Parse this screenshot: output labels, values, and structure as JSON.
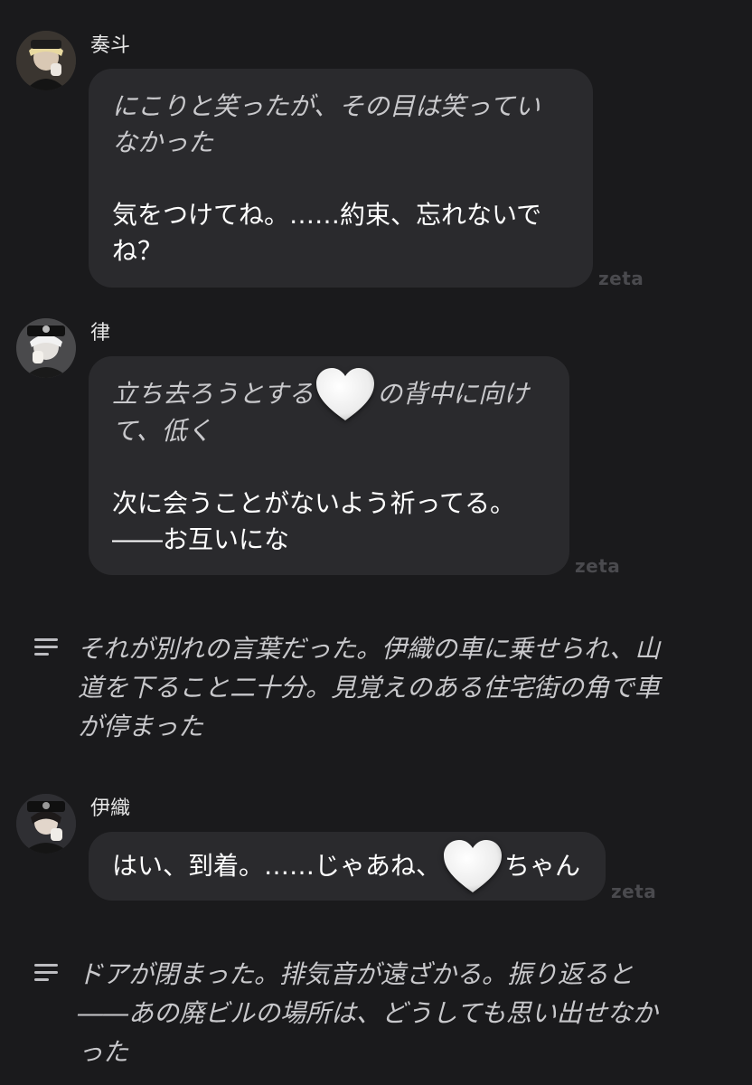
{
  "messages": [
    {
      "speaker": "奏斗",
      "narration": [
        "にこりと笑ったが、その目は笑ってい",
        "なかった"
      ],
      "speech": [
        "気をつけてね。……約束、忘れないで",
        "ね？"
      ],
      "watermark": "zeta"
    },
    {
      "speaker": "律",
      "narration_before_heart": "立ち去ろうとする",
      "narration_after_heart": "の背中に向け",
      "narration_line2": "て、低く",
      "speech": [
        "次に会うことがないよう祈ってる。",
        "――お互いにな"
      ],
      "watermark": "zeta"
    },
    {
      "speaker": "伊織",
      "speech_before_heart": "はい、到着。……じゃあね、",
      "speech_after_heart": "ちゃん",
      "watermark": "zeta"
    }
  ],
  "narrations": [
    [
      "それが別れの言葉だった。伊織の車に乗せられ、山",
      "道を下ること二十分。見覚えのある住宅街の角で車",
      "が停まった"
    ],
    [
      "ドアが閉まった。排気音が遠ざかる。振り返ると",
      "――あの廃ビルの場所は、どうしても思い出せなか",
      "った"
    ]
  ],
  "icons": {
    "heart": "white-heart-emoji",
    "narration": "text-lines-icon"
  },
  "colors": {
    "background": "#1a1a1c",
    "bubble": "#2a2a2d",
    "narration_text": "#c9c9cc",
    "watermark": "#4a4a4e"
  }
}
